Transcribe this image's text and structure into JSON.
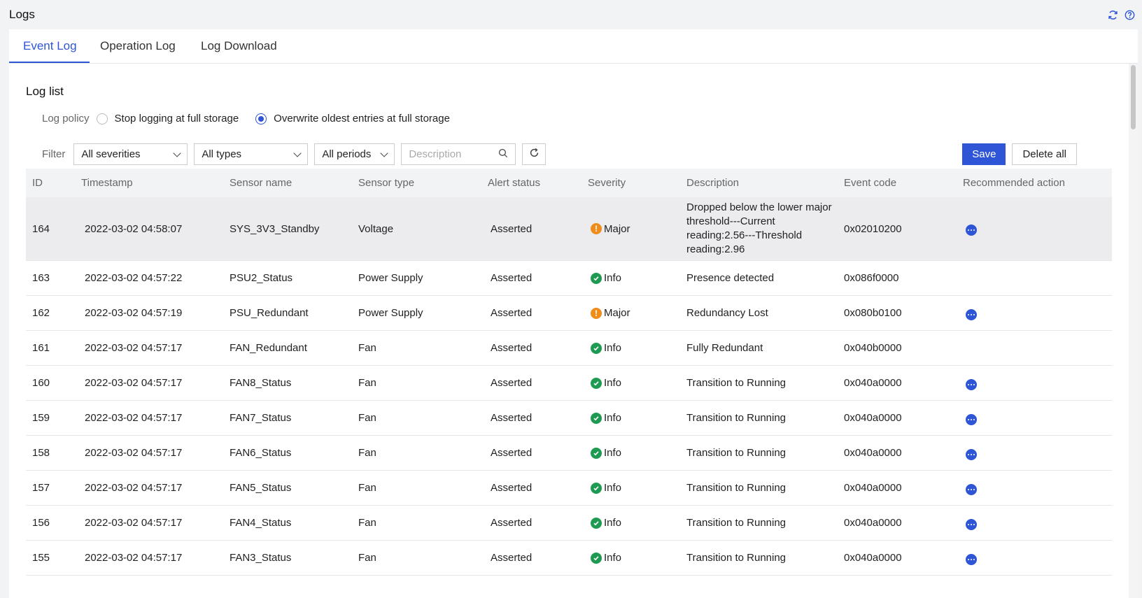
{
  "page": {
    "title": "Logs"
  },
  "tabs": [
    {
      "label": "Event Log",
      "active": true
    },
    {
      "label": "Operation Log",
      "active": false
    },
    {
      "label": "Log Download",
      "active": false
    }
  ],
  "section": {
    "title": "Log list"
  },
  "policy": {
    "label": "Log policy",
    "options": [
      {
        "label": "Stop logging at full storage",
        "checked": false
      },
      {
        "label": "Overwrite oldest entries at full storage",
        "checked": true
      }
    ]
  },
  "filter": {
    "label": "Filter",
    "severity": "All severities",
    "type": "All types",
    "period": "All periods",
    "search_placeholder": "Description"
  },
  "actions": {
    "save": "Save",
    "delete_all": "Delete all"
  },
  "table": {
    "headers": [
      "ID",
      "Timestamp",
      "Sensor name",
      "Sensor type",
      "Alert status",
      "Severity",
      "Description",
      "Event code",
      "Recommended action"
    ],
    "rows": [
      {
        "id": "164",
        "timestamp": "2022-03-02 04:58:07",
        "sensor": "SYS_3V3_Standby",
        "type": "Voltage",
        "status": "Asserted",
        "severity": "Major",
        "description": "Dropped below the lower major threshold---Current reading:2.56---Threshold reading:2.96",
        "code": "0x02010200",
        "action": true
      },
      {
        "id": "163",
        "timestamp": "2022-03-02 04:57:22",
        "sensor": "PSU2_Status",
        "type": "Power Supply",
        "status": "Asserted",
        "severity": "Info",
        "description": "Presence detected",
        "code": "0x086f0000",
        "action": false
      },
      {
        "id": "162",
        "timestamp": "2022-03-02 04:57:19",
        "sensor": "PSU_Redundant",
        "type": "Power Supply",
        "status": "Asserted",
        "severity": "Major",
        "description": "Redundancy Lost",
        "code": "0x080b0100",
        "action": true
      },
      {
        "id": "161",
        "timestamp": "2022-03-02 04:57:17",
        "sensor": "FAN_Redundant",
        "type": "Fan",
        "status": "Asserted",
        "severity": "Info",
        "description": "Fully Redundant",
        "code": "0x040b0000",
        "action": false
      },
      {
        "id": "160",
        "timestamp": "2022-03-02 04:57:17",
        "sensor": "FAN8_Status",
        "type": "Fan",
        "status": "Asserted",
        "severity": "Info",
        "description": "Transition to Running",
        "code": "0x040a0000",
        "action": true
      },
      {
        "id": "159",
        "timestamp": "2022-03-02 04:57:17",
        "sensor": "FAN7_Status",
        "type": "Fan",
        "status": "Asserted",
        "severity": "Info",
        "description": "Transition to Running",
        "code": "0x040a0000",
        "action": true
      },
      {
        "id": "158",
        "timestamp": "2022-03-02 04:57:17",
        "sensor": "FAN6_Status",
        "type": "Fan",
        "status": "Asserted",
        "severity": "Info",
        "description": "Transition to Running",
        "code": "0x040a0000",
        "action": true
      },
      {
        "id": "157",
        "timestamp": "2022-03-02 04:57:17",
        "sensor": "FAN5_Status",
        "type": "Fan",
        "status": "Asserted",
        "severity": "Info",
        "description": "Transition to Running",
        "code": "0x040a0000",
        "action": true
      },
      {
        "id": "156",
        "timestamp": "2022-03-02 04:57:17",
        "sensor": "FAN4_Status",
        "type": "Fan",
        "status": "Asserted",
        "severity": "Info",
        "description": "Transition to Running",
        "code": "0x040a0000",
        "action": true
      },
      {
        "id": "155",
        "timestamp": "2022-03-02 04:57:17",
        "sensor": "FAN3_Status",
        "type": "Fan",
        "status": "Asserted",
        "severity": "Info",
        "description": "Transition to Running",
        "code": "0x040a0000",
        "action": true
      }
    ]
  },
  "icons": {
    "refresh": "refresh-icon",
    "help": "help-icon",
    "search": "search-icon",
    "more": "more-icon",
    "major": "warning-icon",
    "info": "check-circle-icon"
  },
  "colors": {
    "accent": "#2d55d6",
    "major": "#f08c1a",
    "info": "#1f9a53"
  }
}
